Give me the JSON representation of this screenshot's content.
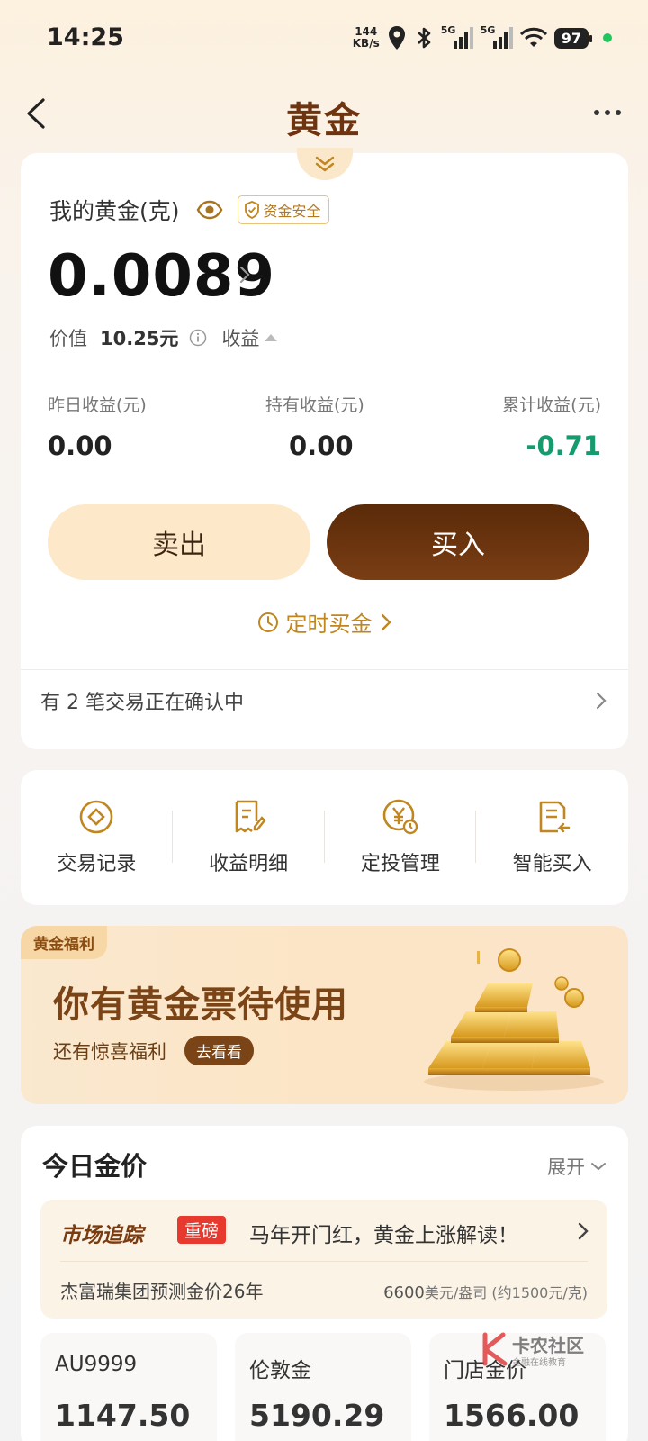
{
  "status_bar": {
    "time": "14:25",
    "speed_value": "144",
    "speed_unit": "KB/s",
    "sim1_label": "5G",
    "sim2_label": "5G",
    "battery": "97"
  },
  "nav": {
    "title": "黄金"
  },
  "holdings": {
    "label": "我的黄金(克)",
    "safety_badge": "资金安全",
    "amount": "0.0089",
    "value_label": "价值",
    "value_amount": "10.25元",
    "income_toggle": "收益",
    "stats": [
      {
        "label": "昨日收益(元)",
        "value": "0.00"
      },
      {
        "label": "持有收益(元)",
        "value": "0.00"
      },
      {
        "label": "累计收益(元)",
        "value": "-0.71"
      }
    ],
    "sell_label": "卖出",
    "buy_label": "买入",
    "timed_buy_label": "定时买金",
    "pending_text": "有 2 笔交易正在确认中"
  },
  "quick_actions": [
    {
      "label": "交易记录",
      "icon": "target-icon"
    },
    {
      "label": "收益明细",
      "icon": "receipt-edit-icon"
    },
    {
      "label": "定投管理",
      "icon": "yen-clock-icon"
    },
    {
      "label": "智能买入",
      "icon": "document-return-icon"
    }
  ],
  "banner": {
    "tag": "黄金福利",
    "title": "你有黄金票待使用",
    "subtitle": "还有惊喜福利",
    "button": "去看看"
  },
  "today_price": {
    "title": "今日金价",
    "expand_label": "展开",
    "market": {
      "logo": "市场追踪",
      "tag": "重磅",
      "headline": "马年开门红，黄金上涨解读！",
      "desc": "杰富瑞集团预测金价26年",
      "price": "6600",
      "price_unit": "美元/盎司",
      "approx": "(约1500元/克)"
    },
    "tiles": [
      {
        "name": "AU9999",
        "price": "1147.50"
      },
      {
        "name": "伦敦金",
        "price": "5190.29"
      },
      {
        "name": "门店金价",
        "price": "1566.00"
      }
    ]
  },
  "watermark": {
    "main": "卡农社区",
    "sub": "金融在线教育"
  },
  "colors": {
    "brand_brown": "#6e3410",
    "gold_accent": "#c08620",
    "loss_green": "#169a6e",
    "tag_red": "#e8392e"
  }
}
